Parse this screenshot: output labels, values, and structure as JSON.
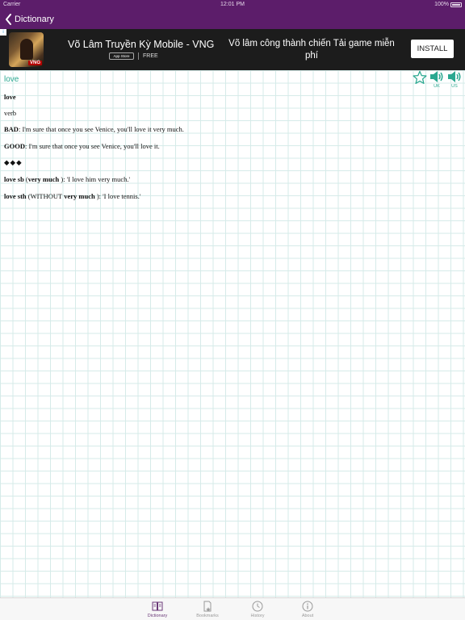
{
  "status_bar": {
    "carrier": "Carrier",
    "time": "12:01 PM",
    "battery": "100%"
  },
  "nav": {
    "back_label": "Dictionary"
  },
  "ad": {
    "title": "Võ Lâm Truyền Kỳ Mobile - VNG",
    "store_badge": "App Store",
    "price": "FREE",
    "promo": "Võ lâm công thành chiến Tải game miễn phí",
    "install": "INSTALL",
    "icon_badge": "VNG"
  },
  "entry": {
    "header_word": "love",
    "word": "love",
    "pos": "verb",
    "bad_label": "BAD",
    "bad_text": ": I'm sure that once you see Venice, you'll love it very much.",
    "good_label": "GOOD",
    "good_text": ": I'm sure that once you see Venice, you'll love it.",
    "separator": "◆◆◆",
    "rule1_word": "love sb",
    "rule1_open": " (",
    "rule1_bold": "very much",
    "rule1_rest": " ): 'I love him very much.'",
    "rule2_word": "love sth",
    "rule2_open": " (WITHOUT ",
    "rule2_bold": "very much",
    "rule2_rest": " ): 'I love tennis.'"
  },
  "speakers": {
    "uk": "UK",
    "us": "US"
  },
  "tabs": [
    {
      "label": "Dictionary",
      "icon": "book-icon",
      "active": true
    },
    {
      "label": "Bookmarks",
      "icon": "bookmark-icon",
      "active": false
    },
    {
      "label": "History",
      "icon": "clock-icon",
      "active": false
    },
    {
      "label": "About",
      "icon": "info-icon",
      "active": false
    }
  ],
  "colors": {
    "brand": "#5c1d6a",
    "accent": "#2aa890",
    "tab_active": "#6b3a78"
  }
}
